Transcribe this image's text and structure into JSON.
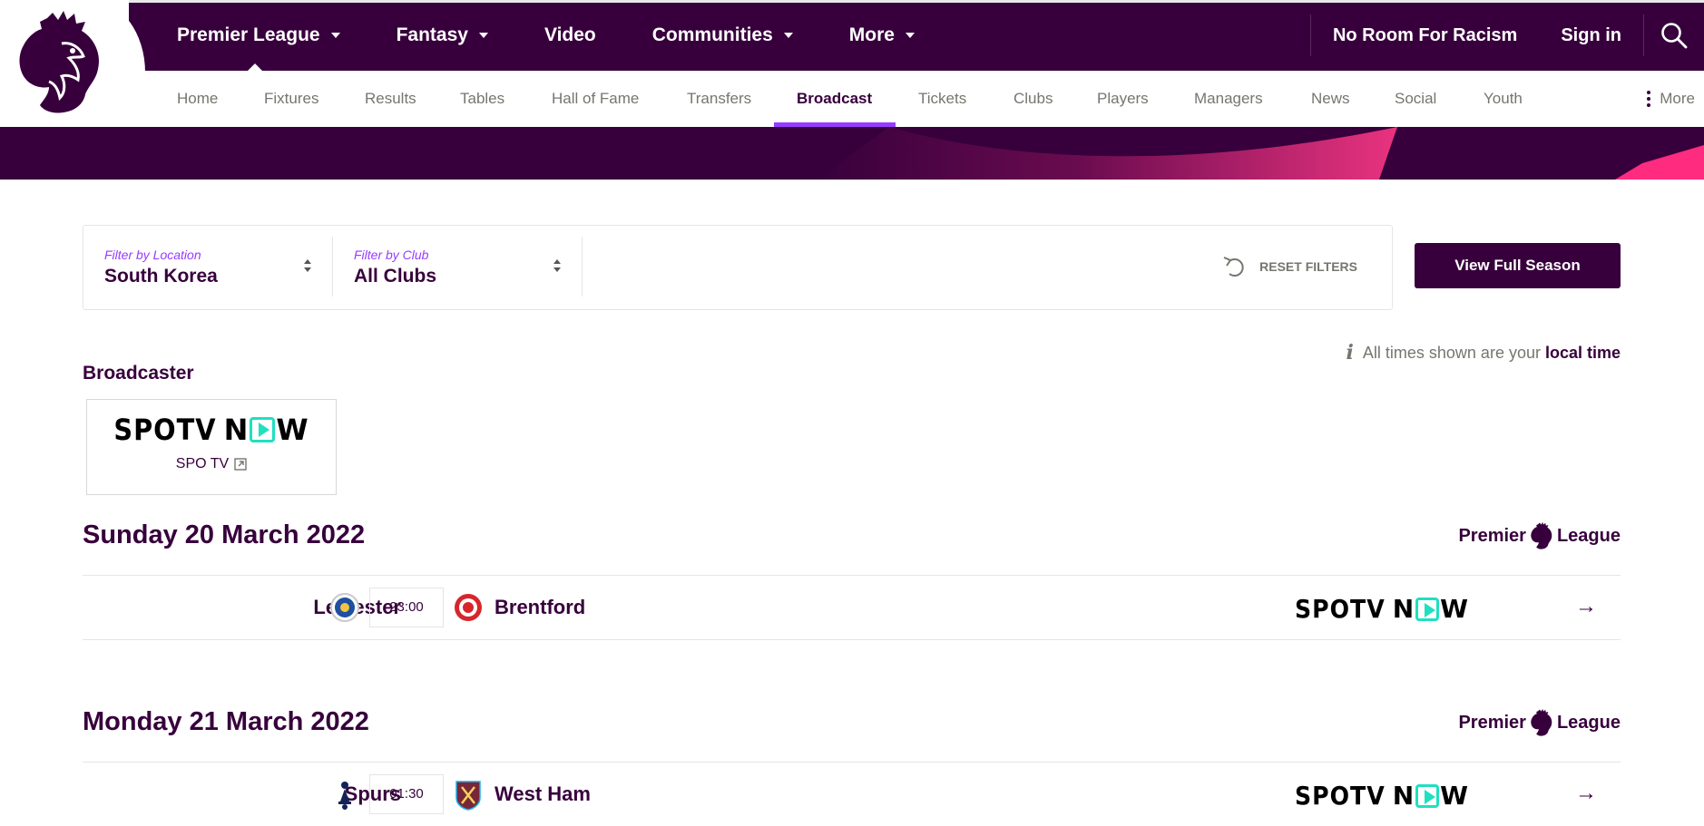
{
  "header": {
    "main_nav": [
      {
        "label": "Premier League",
        "has_dropdown": true
      },
      {
        "label": "Fantasy",
        "has_dropdown": true
      },
      {
        "label": "Video",
        "has_dropdown": false
      },
      {
        "label": "Communities",
        "has_dropdown": true
      },
      {
        "label": "More",
        "has_dropdown": true
      }
    ],
    "no_room_for_racism": "No Room For Racism",
    "sign_in": "Sign in",
    "search_icon": "search-icon"
  },
  "subnav": {
    "items": [
      "Home",
      "Fixtures",
      "Results",
      "Tables",
      "Hall of Fame",
      "Transfers",
      "Broadcast",
      "Tickets",
      "Clubs",
      "Players",
      "Managers",
      "News",
      "Social",
      "Youth"
    ],
    "active": "Broadcast",
    "more": "More"
  },
  "filters": {
    "location_label": "Filter by Location",
    "location_value": "South Korea",
    "club_label": "Filter by Club",
    "club_value": "All Clubs",
    "reset": "RESET FILTERS"
  },
  "view_full_season": "View Full Season",
  "info": {
    "text": "All times shown are your",
    "bold": "local time"
  },
  "broadcaster": {
    "heading": "Broadcaster",
    "name": "SPO TV",
    "logo_text_a": "SPOTV",
    "logo_text_b": "N",
    "logo_text_c": "W"
  },
  "competition_logo_text": [
    "Premier",
    "League"
  ],
  "days": [
    {
      "date": "Sunday 20 March 2022",
      "matches": [
        {
          "home": "Leicester",
          "time": "23:00",
          "away": "Brentford"
        }
      ]
    },
    {
      "date": "Monday 21 March 2022",
      "matches": [
        {
          "home": "Spurs",
          "time": "01:30",
          "away": "West Ham"
        }
      ]
    }
  ],
  "colors": {
    "primary": "#37003c",
    "accent": "#963cff",
    "pink": "#e90052",
    "spotv_teal": "#1fe0c0"
  }
}
